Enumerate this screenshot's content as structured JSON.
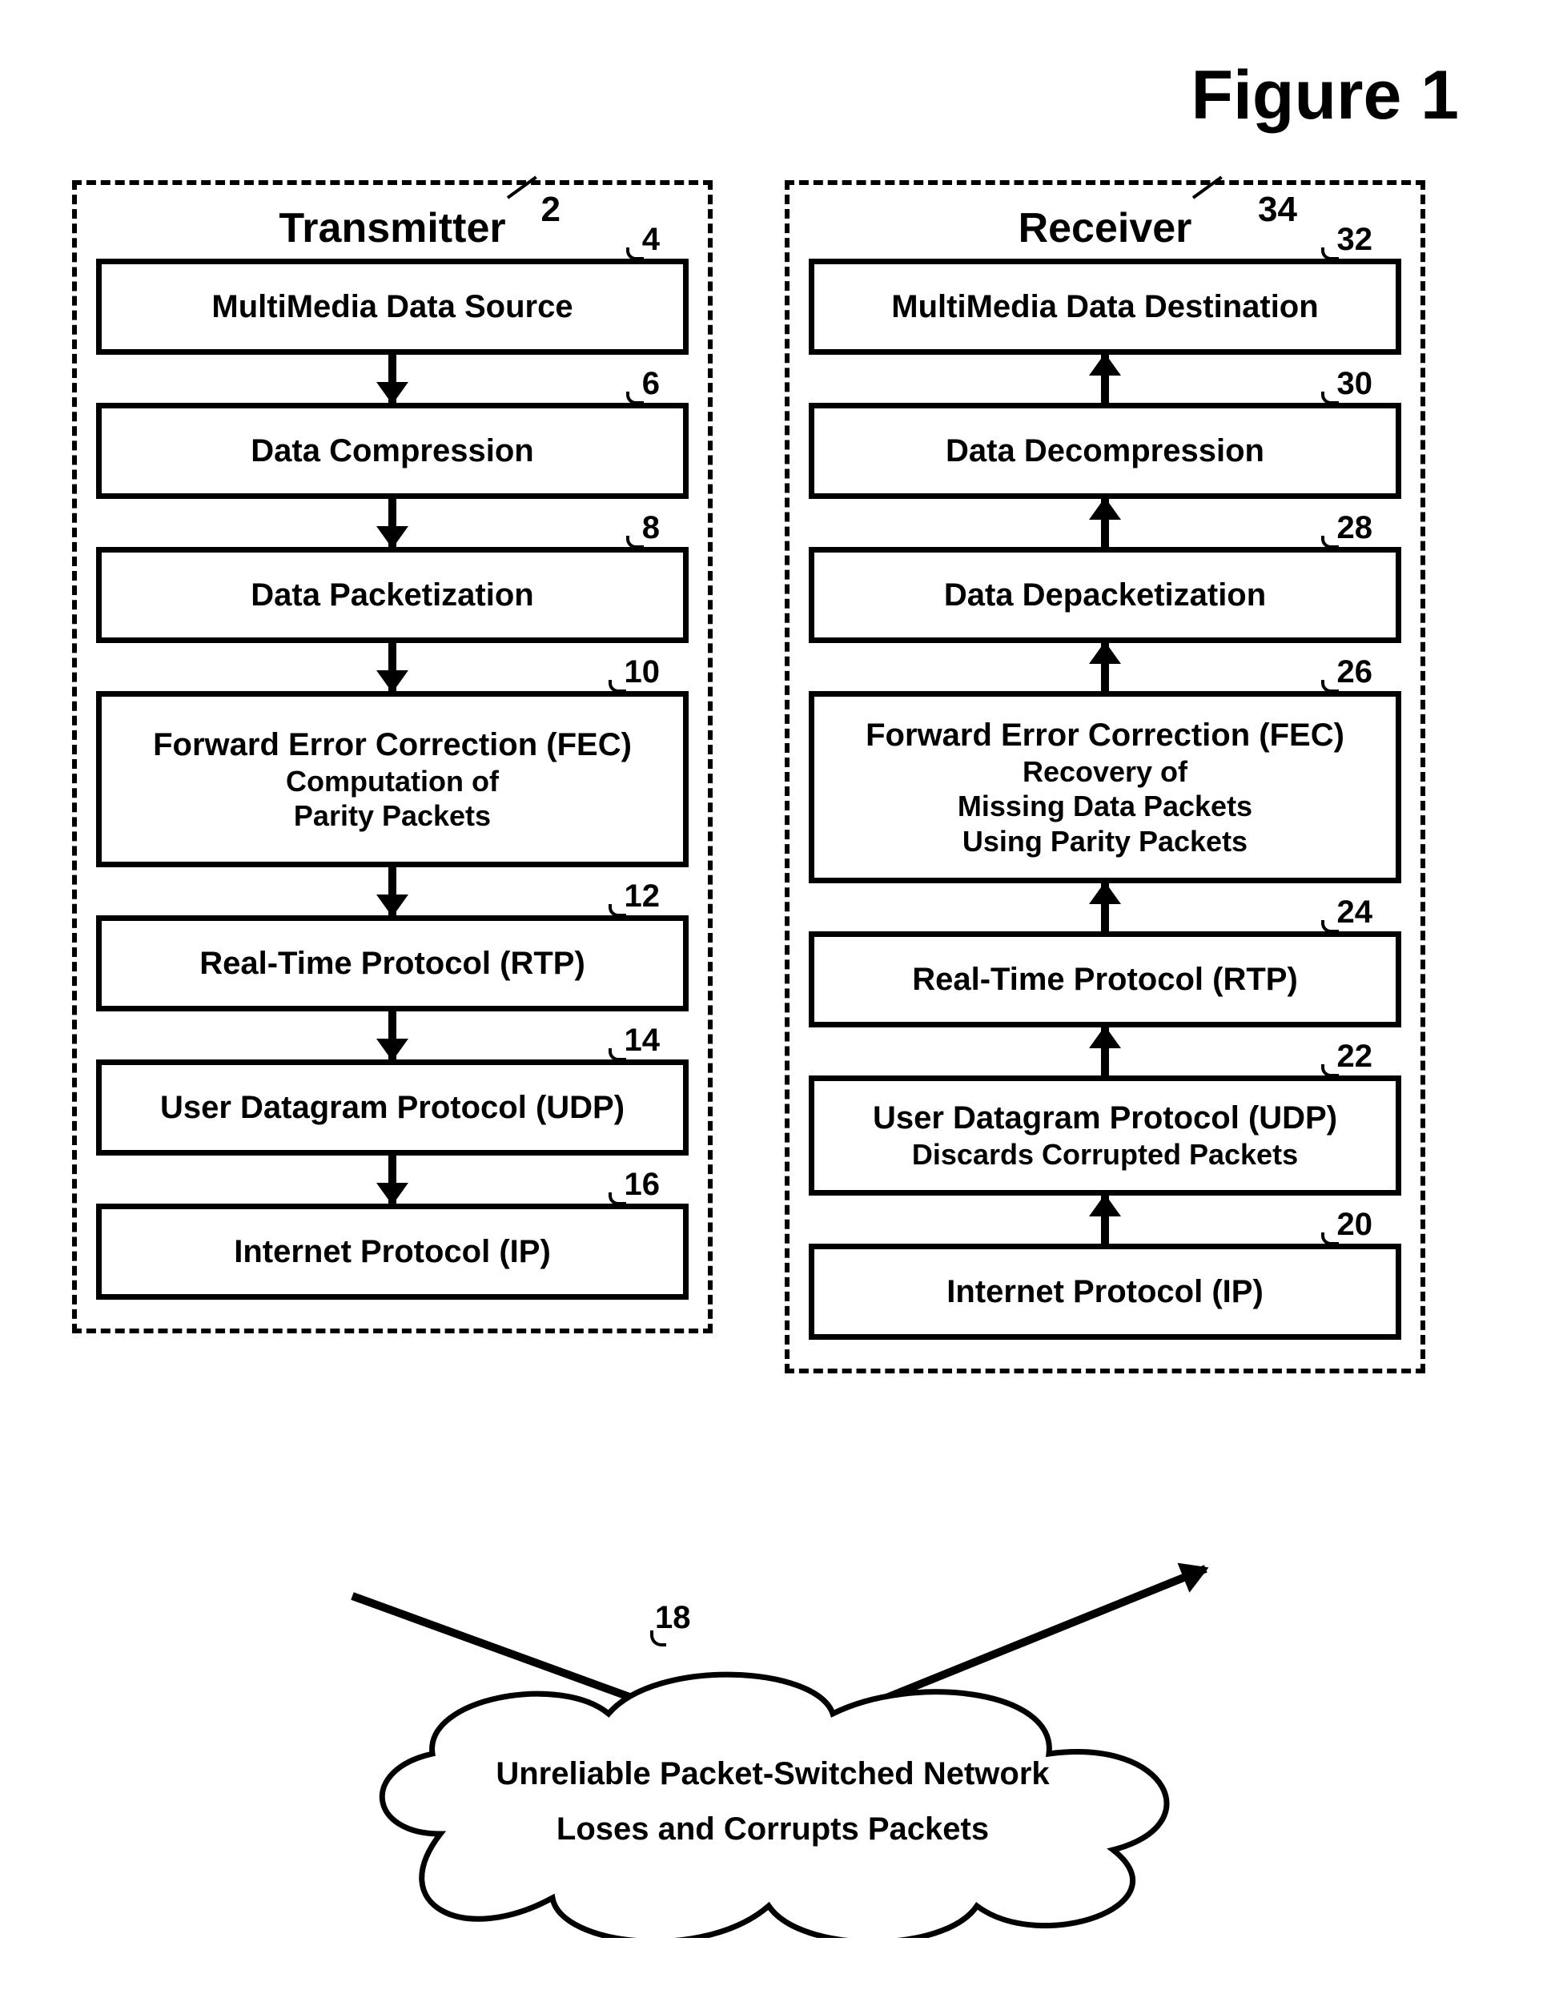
{
  "figure_title": "Figure 1",
  "transmitter": {
    "title": "Transmitter",
    "ref": "2",
    "blocks": [
      {
        "ref": "4",
        "line1": "MultiMedia Data Source"
      },
      {
        "ref": "6",
        "line1": "Data Compression"
      },
      {
        "ref": "8",
        "line1": "Data Packetization"
      },
      {
        "ref": "10",
        "line1": "Forward Error Correction (FEC)",
        "line2": "Computation of",
        "line3": "Parity Packets"
      },
      {
        "ref": "12",
        "line1": "Real-Time Protocol (RTP)"
      },
      {
        "ref": "14",
        "line1": "User Datagram Protocol (UDP)"
      },
      {
        "ref": "16",
        "line1": "Internet Protocol (IP)"
      }
    ]
  },
  "receiver": {
    "title": "Receiver",
    "ref": "34",
    "blocks": [
      {
        "ref": "32",
        "line1": "MultiMedia Data Destination"
      },
      {
        "ref": "30",
        "line1": "Data Decompression"
      },
      {
        "ref": "28",
        "line1": "Data Depacketization"
      },
      {
        "ref": "26",
        "line1": "Forward Error Correction (FEC)",
        "line2": "Recovery of",
        "line3": "Missing Data Packets",
        "line4": "Using Parity Packets"
      },
      {
        "ref": "24",
        "line1": "Real-Time Protocol (RTP)"
      },
      {
        "ref": "22",
        "line1": "User Datagram Protocol (UDP)",
        "line2": "Discards Corrupted Packets"
      },
      {
        "ref": "20",
        "line1": "Internet Protocol (IP)"
      }
    ]
  },
  "network": {
    "ref": "18",
    "line1": "Unreliable Packet-Switched Network",
    "line2": "Loses and Corrupts Packets"
  }
}
